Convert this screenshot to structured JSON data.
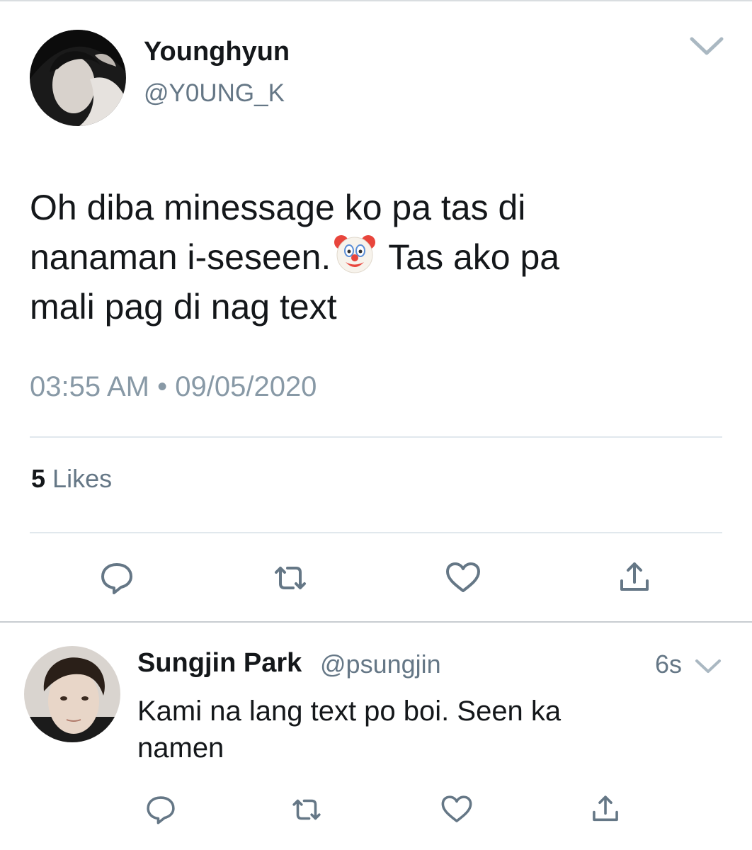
{
  "tweet": {
    "author": {
      "display_name": "Younghyun",
      "handle": "@Y0UNG_K"
    },
    "text_lines": [
      "Oh diba minessage ko pa tas di",
      "nanaman i-seseen.",
      "Tas ako pa",
      "mali pag di nag text"
    ],
    "emoji": "clown-face",
    "timestamp": "03:55 AM • 09/05/2020",
    "likes_count": "5",
    "likes_label": "Likes"
  },
  "reply": {
    "author": {
      "display_name": "Sungjin Park",
      "handle": "@psungjin"
    },
    "time": "6s",
    "text_lines": [
      "Kami na lang text po boi. Seen ka",
      "namen"
    ]
  },
  "icons": {
    "caret": "chevron-down-icon",
    "reply": "reply-icon",
    "retweet": "retweet-icon",
    "like": "heart-icon",
    "share": "share-icon"
  },
  "colors": {
    "text_primary": "#14171a",
    "text_secondary": "#657786",
    "icon_gray": "#657786",
    "divider": "#e1e8ed"
  }
}
